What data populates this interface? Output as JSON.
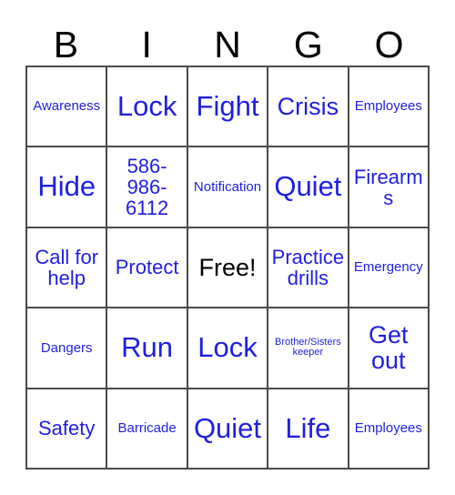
{
  "card": {
    "title": "Bingo Card",
    "header_letters": [
      "B",
      "I",
      "N",
      "G",
      "O"
    ],
    "header_color": "#000000",
    "text_color": "#1f1fe0",
    "free_color": "#000000",
    "border_color": "#4a4a4a",
    "background": "#ffffff",
    "columns": 5,
    "rows": 5,
    "cells": [
      {
        "label": "Awareness",
        "size": "sm",
        "color": "blue"
      },
      {
        "label": "Lock",
        "size": "xl",
        "color": "blue"
      },
      {
        "label": "Fight",
        "size": "xl",
        "color": "blue"
      },
      {
        "label": "Crisis",
        "size": "lg",
        "color": "blue"
      },
      {
        "label": "Employees",
        "size": "sm",
        "color": "blue"
      },
      {
        "label": "Hide",
        "size": "xl",
        "color": "blue"
      },
      {
        "label": "586-986-6112",
        "size": "md",
        "color": "blue"
      },
      {
        "label": "Notification",
        "size": "sm",
        "color": "blue"
      },
      {
        "label": "Quiet",
        "size": "xl",
        "color": "blue"
      },
      {
        "label": "Firearms",
        "size": "md",
        "color": "blue"
      },
      {
        "label": "Call for help",
        "size": "md",
        "color": "blue"
      },
      {
        "label": "Protect",
        "size": "md",
        "color": "blue"
      },
      {
        "label": "Free!",
        "size": "lg",
        "color": "black"
      },
      {
        "label": "Practice drills",
        "size": "md",
        "color": "blue"
      },
      {
        "label": "Emergency",
        "size": "sm",
        "color": "blue"
      },
      {
        "label": "Dangers",
        "size": "sm",
        "color": "blue"
      },
      {
        "label": "Run",
        "size": "xl",
        "color": "blue"
      },
      {
        "label": "Lock",
        "size": "xl",
        "color": "blue"
      },
      {
        "label": "Brother/Sisters keeper",
        "size": "xs",
        "color": "blue"
      },
      {
        "label": "Get out",
        "size": "lg",
        "color": "blue"
      },
      {
        "label": "Safety",
        "size": "md",
        "color": "blue"
      },
      {
        "label": "Barricade",
        "size": "sm",
        "color": "blue"
      },
      {
        "label": "Quiet",
        "size": "xl",
        "color": "blue"
      },
      {
        "label": "Life",
        "size": "xl",
        "color": "blue"
      },
      {
        "label": "Employees",
        "size": "sm",
        "color": "blue"
      }
    ]
  }
}
